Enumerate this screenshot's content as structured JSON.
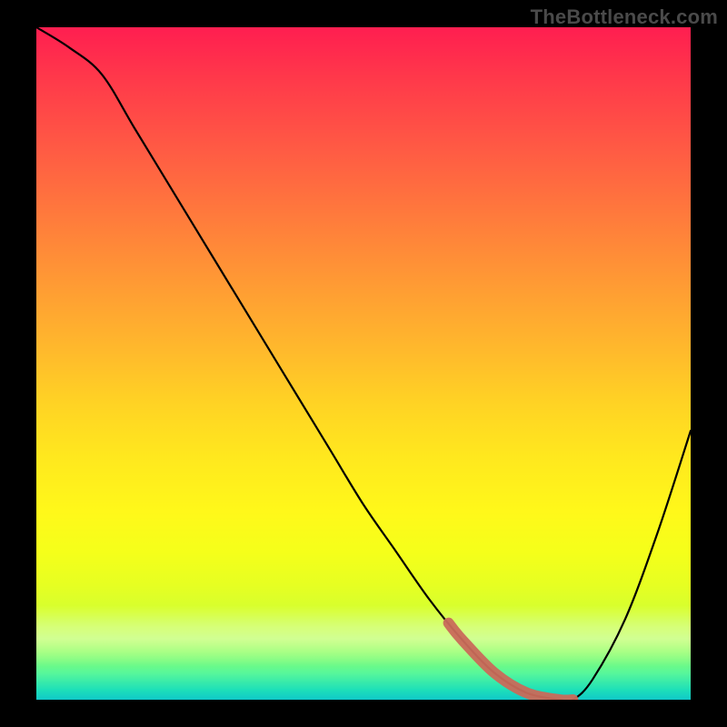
{
  "watermark": "TheBottleneck.com",
  "chart_data": {
    "type": "line",
    "title": "",
    "xlabel": "",
    "ylabel": "",
    "xlim": [
      0,
      100
    ],
    "ylim": [
      0,
      100
    ],
    "grid": false,
    "series": [
      {
        "name": "curve",
        "x": [
          0,
          5,
          10,
          15,
          20,
          25,
          30,
          35,
          40,
          45,
          50,
          55,
          60,
          65,
          70,
          75,
          80,
          82,
          85,
          90,
          95,
          100
        ],
        "values": [
          100,
          97,
          93,
          85,
          77,
          69,
          61,
          53,
          45,
          37,
          29,
          22,
          15,
          9,
          4,
          1,
          0,
          0,
          3,
          12,
          25,
          40
        ]
      }
    ],
    "highlight_range_x": [
      63,
      82
    ],
    "background_gradient": {
      "top": "#ff1e50",
      "mid": "#ffe81e",
      "bottom": "#10c8c8"
    }
  }
}
